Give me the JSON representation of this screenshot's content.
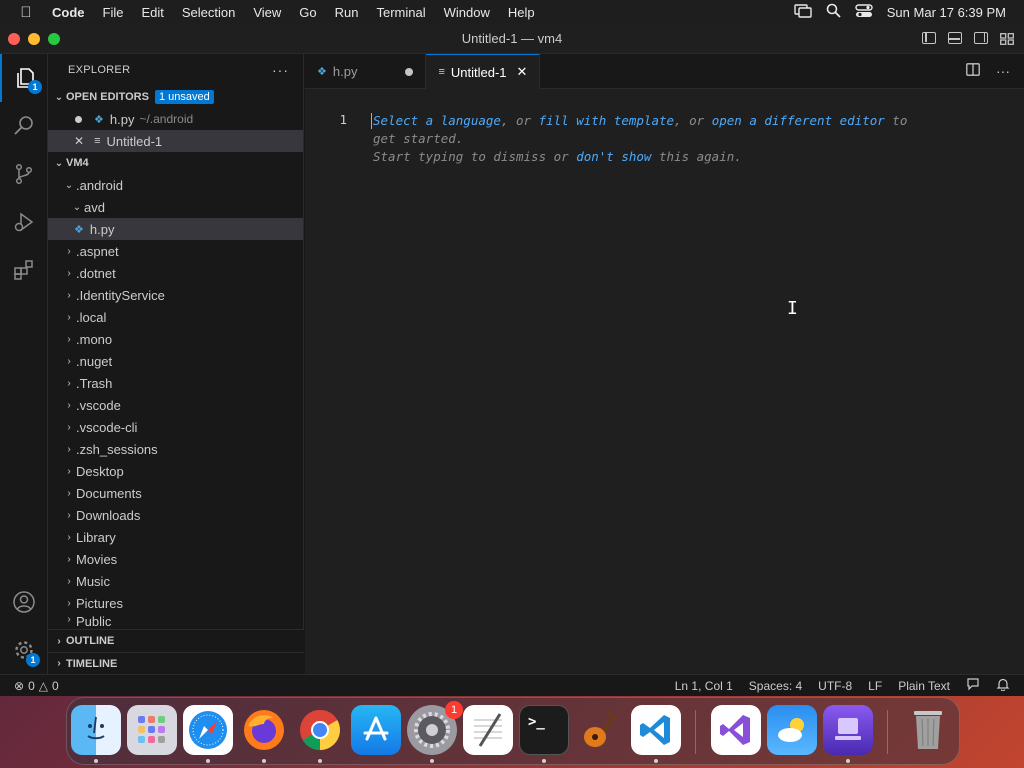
{
  "menubar": {
    "app_name": "Code",
    "items": [
      "File",
      "Edit",
      "Selection",
      "View",
      "Go",
      "Run",
      "Terminal",
      "Window",
      "Help"
    ],
    "datetime": "Sun Mar 17  6:39 PM"
  },
  "window": {
    "title": "Untitled-1 — vm4"
  },
  "activity": {
    "explorer_badge": "1",
    "settings_badge": "1"
  },
  "sidebar": {
    "header": "EXPLORER",
    "more": "···",
    "open_editors": {
      "label": "OPEN EDITORS",
      "badge": "1 unsaved",
      "items": [
        {
          "name": "h.py",
          "desc": "~/.android"
        },
        {
          "name": "Untitled-1"
        }
      ]
    },
    "workspace": {
      "label": "VM4",
      "tree": [
        ".android",
        "avd",
        "h.py",
        ".aspnet",
        ".dotnet",
        ".IdentityService",
        ".local",
        ".mono",
        ".nuget",
        ".Trash",
        ".vscode",
        ".vscode-cli",
        ".zsh_sessions",
        "Desktop",
        "Documents",
        "Downloads",
        "Library",
        "Movies",
        "Music",
        "Pictures",
        "Public"
      ]
    },
    "outline": "OUTLINE",
    "timeline": "TIMELINE"
  },
  "tabs": [
    {
      "label": "h.py"
    },
    {
      "label": "Untitled-1"
    }
  ],
  "editor": {
    "line_number": "1",
    "hint": {
      "t1": "Select a language",
      "t2": ", or ",
      "t3": "fill with template",
      "t4": ", or ",
      "t5": "open a different editor",
      "t6": " to get started.",
      "t7": "Start typing to dismiss or ",
      "t8": "don't show",
      "t9": " this again."
    }
  },
  "status": {
    "errors": "0",
    "warnings": "0",
    "position": "Ln 1, Col 1",
    "spaces": "Spaces: 4",
    "encoding": "UTF-8",
    "eol": "LF",
    "language": "Plain Text"
  },
  "dock": {
    "apps": [
      "finder-icon",
      "launchpad-icon",
      "safari-icon",
      "firefox-icon",
      "chrome-icon",
      "app-store-icon",
      "system-settings-icon",
      "textedit-icon",
      "terminal-icon",
      "garageband-icon",
      "vscode-icon",
      "visual-studio-icon",
      "weather-icon",
      "simulator-icon",
      "trash-icon"
    ],
    "settings_badge": "1"
  }
}
